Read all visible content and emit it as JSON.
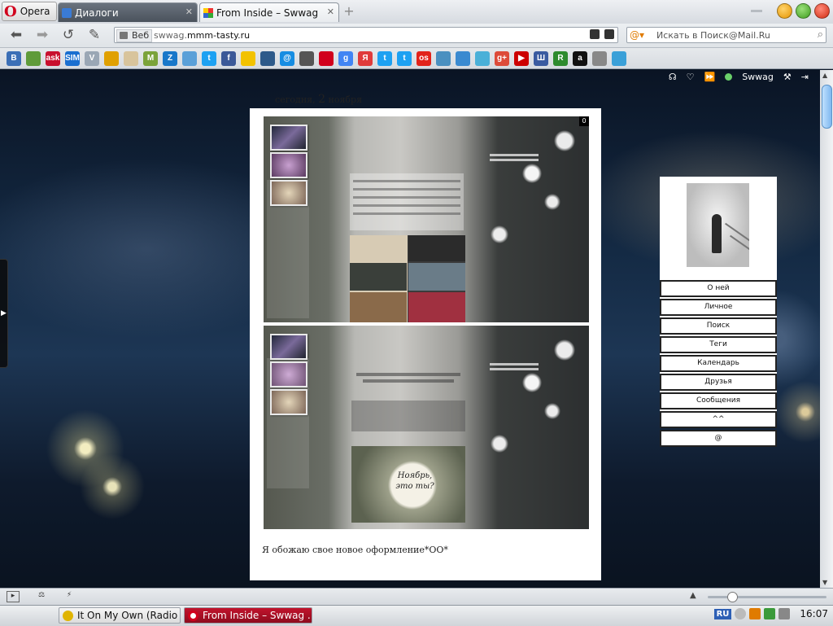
{
  "browser": {
    "opera_label": "Opera",
    "tabs": [
      {
        "title": "Диалоги",
        "active": false
      },
      {
        "title": "From Inside – Swwag",
        "active": true
      }
    ],
    "address": {
      "scheme_label": "Веб",
      "url_prefix": "swwag.",
      "url_domain": "mmm-tasty.ru"
    },
    "search_placeholder": "Искать в Поиск@Mail.Ru"
  },
  "bookmarks": [
    {
      "label": "B",
      "color": "#3b6fb6"
    },
    {
      "label": "",
      "color": "#5f9b3a"
    },
    {
      "label": "ask",
      "color": "#c8102e"
    },
    {
      "label": "SIM",
      "color": "#1a6fd0"
    },
    {
      "label": "V",
      "color": "#9aa7b5"
    },
    {
      "label": "",
      "color": "#e0a000"
    },
    {
      "label": "",
      "color": "#d8c49c"
    },
    {
      "label": "M",
      "color": "#7ba33a"
    },
    {
      "label": "Z",
      "color": "#1877c9"
    },
    {
      "label": "",
      "color": "#5aa0d8"
    },
    {
      "label": "t",
      "color": "#1da1f2"
    },
    {
      "label": "f",
      "color": "#3b5998"
    },
    {
      "label": "",
      "color": "#f2c200"
    },
    {
      "label": "",
      "color": "#2d5a8a"
    },
    {
      "label": "@",
      "color": "#168de2"
    },
    {
      "label": "",
      "color": "#555555"
    },
    {
      "label": "",
      "color": "#d1001c"
    },
    {
      "label": "g",
      "color": "#4285f4"
    },
    {
      "label": "Я",
      "color": "#e03b3b"
    },
    {
      "label": "t",
      "color": "#1da1f2"
    },
    {
      "label": "t",
      "color": "#1da1f2"
    },
    {
      "label": "os",
      "color": "#e2231a"
    },
    {
      "label": "",
      "color": "#4a90c0"
    },
    {
      "label": "",
      "color": "#3a8ad0"
    },
    {
      "label": "",
      "color": "#4ab0d8"
    },
    {
      "label": "g+",
      "color": "#dd4b39"
    },
    {
      "label": "▶",
      "color": "#cc0000"
    },
    {
      "label": "Ш",
      "color": "#3a5ba0"
    },
    {
      "label": "R",
      "color": "#2e8b2e"
    },
    {
      "label": "a",
      "color": "#111111"
    },
    {
      "label": "",
      "color": "#888888"
    },
    {
      "label": "",
      "color": "#3aa0d8"
    }
  ],
  "page": {
    "user": "Swwag",
    "date": {
      "prefix": "сегодня,",
      "day": "2",
      "month": "ноября"
    },
    "post_caption": "Я обожаю свое новое оформление*ОО*",
    "nov_text": "Ноябрь, это ты?",
    "badge": "0",
    "menu": [
      "О ней",
      "Личное",
      "Поиск",
      "Теги",
      "Календарь",
      "Друзья",
      "Сообщения",
      "^^",
      "@"
    ]
  },
  "taskbar": {
    "items": [
      {
        "label": "It On My Own (Radio ..."
      },
      {
        "label": "From Inside – Swwag ..."
      }
    ],
    "lang": "RU",
    "clock": "16:07"
  }
}
